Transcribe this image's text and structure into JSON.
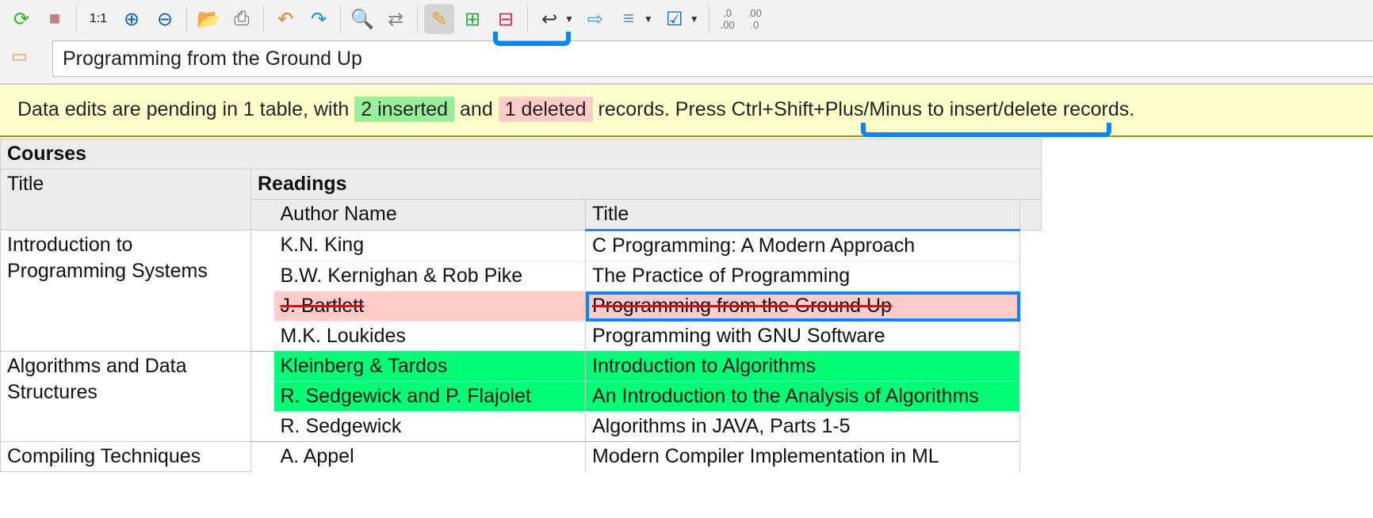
{
  "toolbar": {
    "buttons": [
      {
        "name": "refresh-icon",
        "glyph": "⟳",
        "color": "#22bb22"
      },
      {
        "name": "stop-icon",
        "glyph": "■",
        "color": "#c08080"
      },
      {
        "sep": true
      },
      {
        "name": "actual-size-icon",
        "glyph": "1:1",
        "color": "#111"
      },
      {
        "name": "zoom-in-icon",
        "glyph": "⊕",
        "color": "#1060c0"
      },
      {
        "name": "zoom-out-icon",
        "glyph": "⊖",
        "color": "#1060c0"
      },
      {
        "sep": true
      },
      {
        "name": "open-folder-icon",
        "glyph": "📂",
        "color": "#e0b040"
      },
      {
        "name": "print-icon",
        "glyph": "⎙",
        "color": "#666"
      },
      {
        "sep": true
      },
      {
        "name": "undo-icon",
        "glyph": "↶",
        "color": "#e08020"
      },
      {
        "name": "redo-icon",
        "glyph": "↷",
        "color": "#1090d0"
      },
      {
        "sep": true
      },
      {
        "name": "find-icon",
        "glyph": "🔍",
        "color": "#1060c0"
      },
      {
        "name": "find-replace-icon",
        "glyph": "⇄",
        "color": "#888"
      },
      {
        "sep": true
      },
      {
        "name": "edit-data-icon",
        "glyph": "✎",
        "color": "#e0a020",
        "active": true
      },
      {
        "name": "insert-record-icon",
        "glyph": "⊞",
        "color": "#20b040"
      },
      {
        "name": "delete-record-icon",
        "glyph": "⊟",
        "color": "#e02050"
      },
      {
        "sep": true
      },
      {
        "name": "wrap-icon",
        "glyph": "↩",
        "color": "#333",
        "dropdown": true
      },
      {
        "name": "export-icon",
        "glyph": "⇨",
        "color": "#4a90d0"
      },
      {
        "name": "align-icon",
        "glyph": "≡",
        "color": "#6a90c0",
        "dropdown": true
      },
      {
        "name": "checkbox-icon",
        "glyph": "☑",
        "color": "#1060c0",
        "dropdown": true
      },
      {
        "sep": true
      }
    ],
    "decimal_decrease": [
      ".0",
      ".00"
    ],
    "decimal_increase": [
      ".00",
      ".0"
    ]
  },
  "cell_editor": {
    "value": "Programming from the Ground Up"
  },
  "banner": {
    "prefix": "Data edits are pending in 1 table, with",
    "inserted": "2 inserted",
    "and": "and",
    "deleted": "1 deleted",
    "suffix": "records. Press Ctrl+Shift+Plus/Minus to insert/delete records."
  },
  "table": {
    "name": "Courses",
    "col_title": "Title",
    "nested_name": "Readings",
    "nested_cols": [
      "Author Name",
      "Title"
    ],
    "courses": [
      {
        "title": "Introduction to Programming Systems",
        "readings": [
          {
            "author": "K.N. King",
            "title": "C Programming: A Modern Approach"
          },
          {
            "author": "B.W. Kernighan & Rob Pike",
            "title": "The Practice of Programming"
          },
          {
            "author": "J. Bartlett",
            "title": "Programming from the Ground Up",
            "status": "deleted",
            "selected": true
          },
          {
            "author": "M.K. Loukides",
            "title": "Programming with GNU Software"
          }
        ]
      },
      {
        "title": "Algorithms and Data Structures",
        "readings": [
          {
            "author": "Kleinberg & Tardos",
            "title": "Introduction to Algorithms",
            "status": "inserted"
          },
          {
            "author": "R. Sedgewick and P. Flajolet",
            "title": "An Introduction to the Analysis of Algorithms",
            "status": "inserted"
          },
          {
            "author": "R. Sedgewick",
            "title": "Algorithms in JAVA, Parts 1-5"
          }
        ]
      },
      {
        "title": "Compiling Techniques",
        "readings": [
          {
            "author": "A. Appel",
            "title": "Modern Compiler Implementation in ML"
          }
        ]
      }
    ]
  }
}
